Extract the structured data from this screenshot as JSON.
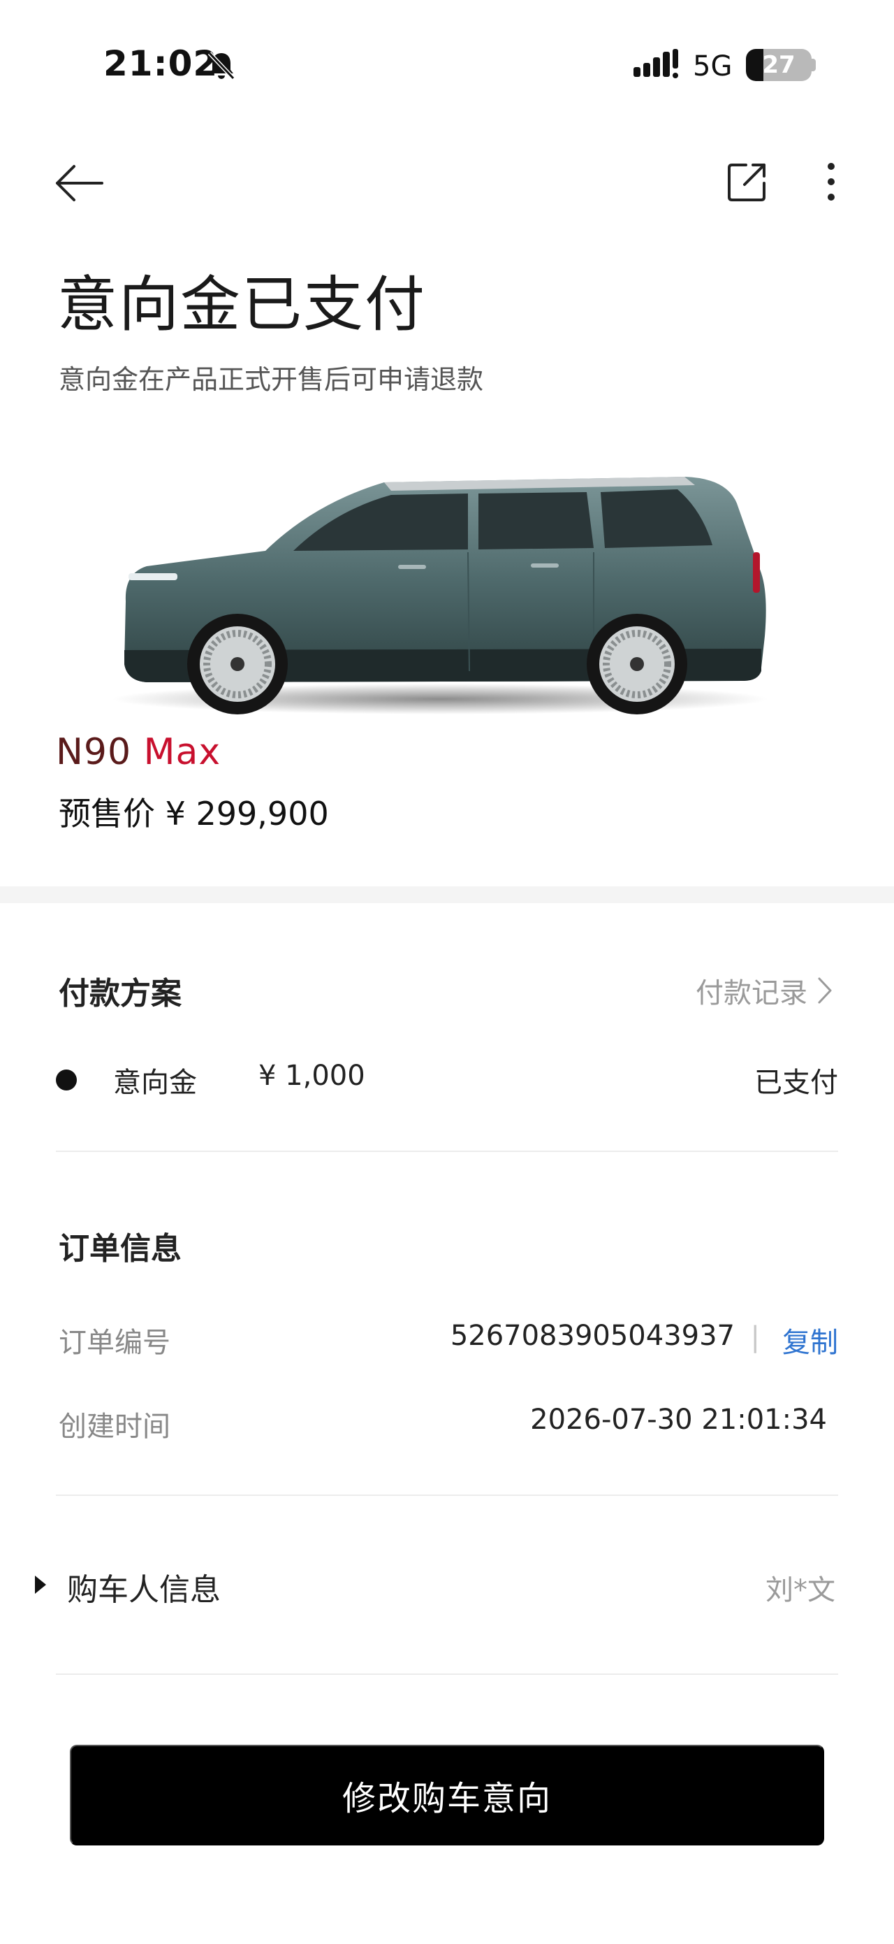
{
  "status_bar": {
    "time": "21:02",
    "network": "5G",
    "battery": "27",
    "battery_level": 0.27
  },
  "header": {
    "title": "意向金已支付",
    "subtitle": "意向金在产品正式开售后可申请退款"
  },
  "vehicle": {
    "model_prefix": "N90",
    "model_suffix": "Max",
    "presale_label": "预售价 ¥ 299,900",
    "body_color": "#4f6a6c",
    "accent_color": "#c8102e"
  },
  "payment_plan": {
    "title": "付款方案",
    "record_link": "付款记录",
    "items": [
      {
        "name": "意向金",
        "amount": "¥ 1,000",
        "status": "已支付"
      }
    ]
  },
  "order_info": {
    "title": "订单信息",
    "order_no_label": "订单编号",
    "order_no": "5267083905043937",
    "separator": "|",
    "copy_label": "复制",
    "created_label": "创建时间",
    "created_time": "2026-07-30 21:01:34",
    "link_color": "#2f74d0"
  },
  "buyer": {
    "title": "购车人信息",
    "name": "刘*文"
  },
  "actions": {
    "primary_label": "修改购车意向"
  },
  "icons": {
    "back": "arrow-left-icon",
    "share": "share-icon",
    "more": "more-vertical-icon",
    "mute": "bell-mute-icon",
    "signal": "signal-icon"
  }
}
